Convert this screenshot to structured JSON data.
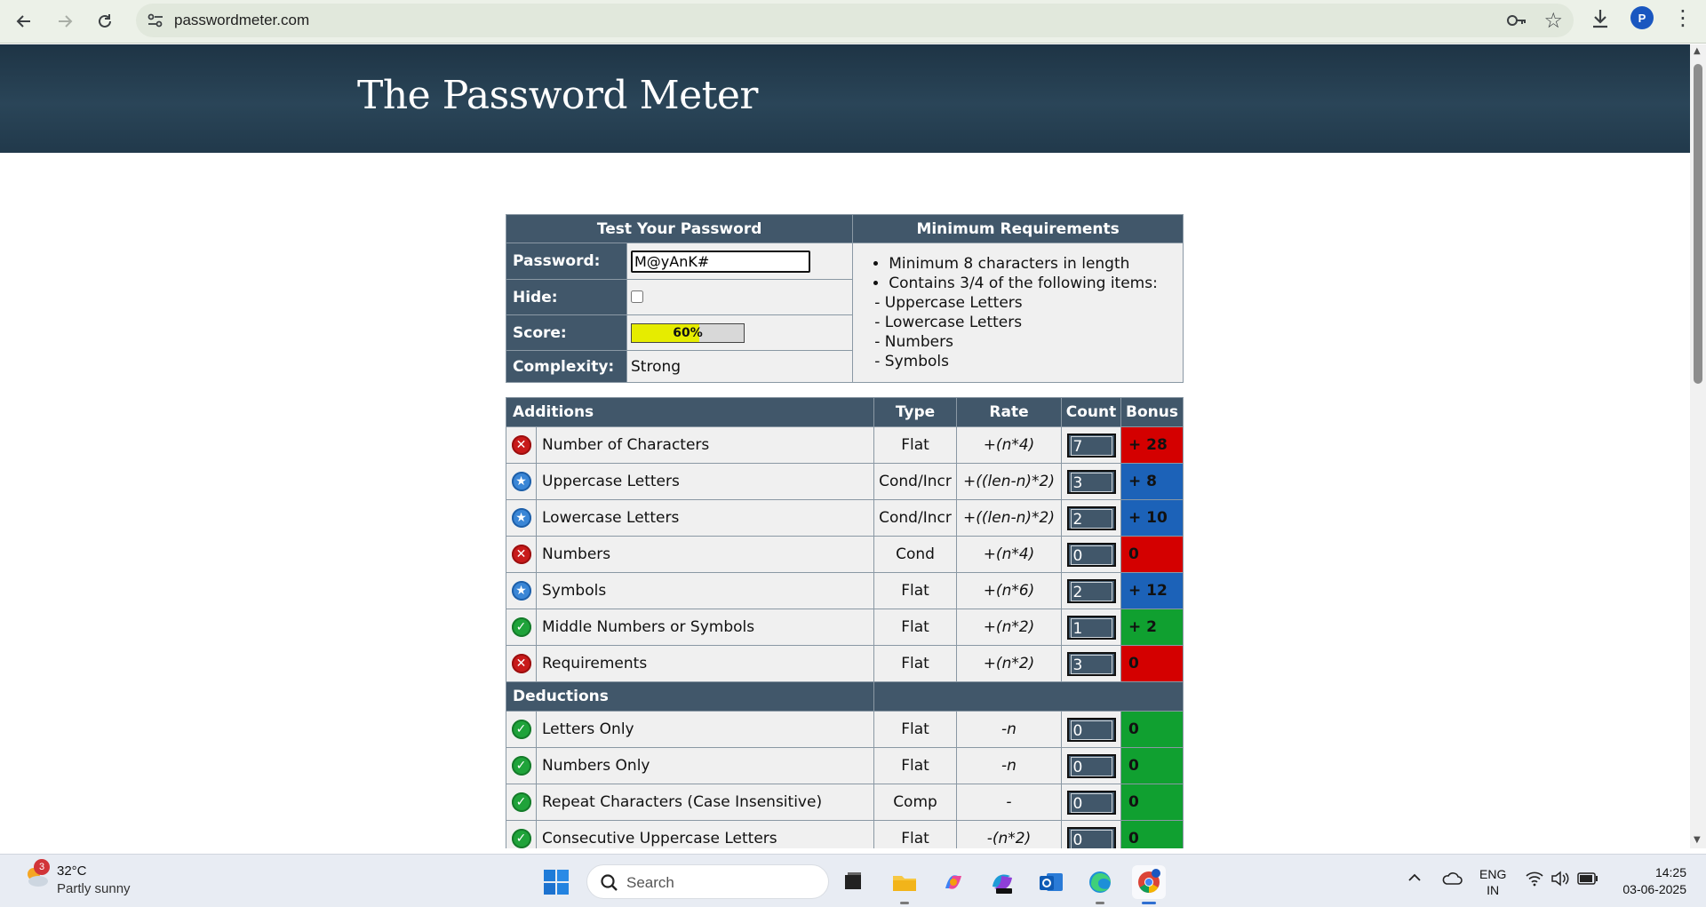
{
  "browser": {
    "url": "passwordmeter.com",
    "profile_initial": "P"
  },
  "site": {
    "title": "The Password Meter"
  },
  "test_panel": {
    "header": "Test Your Password",
    "password_label": "Password:",
    "password_value": "M@yAnK#",
    "hide_label": "Hide:",
    "hide_checked": false,
    "score_label": "Score:",
    "score_text": "60%",
    "score_fraction": 0.6,
    "score_color": "#e6ec00",
    "complexity_label": "Complexity:",
    "complexity_value": "Strong"
  },
  "requirements": {
    "header": "Minimum Requirements",
    "items": [
      "Minimum 8 characters in length",
      "Contains 3/4 of the following items:"
    ],
    "sub_items": [
      "- Uppercase Letters",
      "- Lowercase Letters",
      "- Numbers",
      "- Symbols"
    ]
  },
  "score_table": {
    "columns": {
      "type": "Type",
      "rate": "Rate",
      "count": "Count",
      "bonus": "Bonus"
    },
    "additions_label": "Additions",
    "additions": [
      {
        "status": "fail",
        "name": "Number of Characters",
        "type": "Flat",
        "rate": "+(n*4)",
        "count": "7",
        "bonus": "+ 28",
        "bonus_color": "#d40000"
      },
      {
        "status": "exceed",
        "name": "Uppercase Letters",
        "type": "Cond/Incr",
        "rate": "+((len-n)*2)",
        "count": "3",
        "bonus": "+ 8",
        "bonus_color": "#1c62b8"
      },
      {
        "status": "exceed",
        "name": "Lowercase Letters",
        "type": "Cond/Incr",
        "rate": "+((len-n)*2)",
        "count": "2",
        "bonus": "+ 10",
        "bonus_color": "#1c62b8"
      },
      {
        "status": "fail",
        "name": "Numbers",
        "type": "Cond",
        "rate": "+(n*4)",
        "count": "0",
        "bonus": "0",
        "bonus_color": "#d40000"
      },
      {
        "status": "exceed",
        "name": "Symbols",
        "type": "Flat",
        "rate": "+(n*6)",
        "count": "2",
        "bonus": "+ 12",
        "bonus_color": "#1c62b8"
      },
      {
        "status": "pass",
        "name": "Middle Numbers or Symbols",
        "type": "Flat",
        "rate": "+(n*2)",
        "count": "1",
        "bonus": "+ 2",
        "bonus_color": "#10a030"
      },
      {
        "status": "fail",
        "name": "Requirements",
        "type": "Flat",
        "rate": "+(n*2)",
        "count": "3",
        "bonus": "0",
        "bonus_color": "#d40000"
      }
    ],
    "deductions_label": "Deductions",
    "deductions": [
      {
        "status": "pass",
        "name": "Letters Only",
        "type": "Flat",
        "rate": "-n",
        "count": "0",
        "bonus": "0",
        "bonus_color": "#10a030"
      },
      {
        "status": "pass",
        "name": "Numbers Only",
        "type": "Flat",
        "rate": "-n",
        "count": "0",
        "bonus": "0",
        "bonus_color": "#10a030"
      },
      {
        "status": "pass",
        "name": "Repeat Characters (Case Insensitive)",
        "type": "Comp",
        "rate": "-",
        "count": "0",
        "bonus": "0",
        "bonus_color": "#10a030"
      },
      {
        "status": "pass",
        "name": "Consecutive Uppercase Letters",
        "type": "Flat",
        "rate": "-(n*2)",
        "count": "0",
        "bonus": "0",
        "bonus_color": "#10a030"
      }
    ]
  },
  "taskbar": {
    "weather_badge": "3",
    "weather_temp": "32°C",
    "weather_desc": "Partly sunny",
    "search_placeholder": "Search",
    "lang_line1": "ENG",
    "lang_line2": "IN",
    "time": "14:25",
    "date": "03-06-2025"
  }
}
